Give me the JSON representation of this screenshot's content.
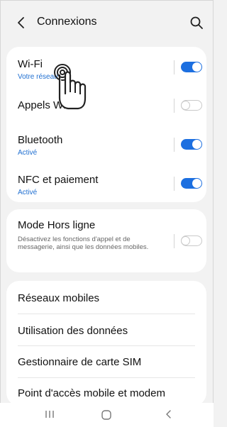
{
  "header": {
    "title": "Connexions",
    "back_icon": "chevron-left-icon",
    "search_icon": "search-icon"
  },
  "toggles": [
    {
      "id": "wifi",
      "title": "Wi-Fi",
      "subtitle": "Votre réseau",
      "state": "on"
    },
    {
      "id": "appels",
      "title": "Appels Wi-Fi",
      "subtitle": "",
      "state": "off"
    },
    {
      "id": "bluetooth",
      "title": "Bluetooth",
      "subtitle": "Activé",
      "state": "on"
    },
    {
      "id": "nfc",
      "title": "NFC et paiement",
      "subtitle": "Activé",
      "state": "on"
    }
  ],
  "airplane": {
    "title": "Mode Hors ligne",
    "description": "Désactivez les fonctions d'appel et de messagerie, ainsi que les données mobiles.",
    "state": "off"
  },
  "list": [
    "Réseaux mobiles",
    "Utilisation des données",
    "Gestionnaire de carte SIM",
    "Point d'accès mobile et modem"
  ],
  "navbar": {
    "recent_icon": "recent-apps-icon",
    "home_icon": "home-icon",
    "back_icon": "back-icon"
  },
  "colors": {
    "accent": "#1c6fe0",
    "toggle_off": "#c9c9c9",
    "background": "#f2f2f2"
  }
}
